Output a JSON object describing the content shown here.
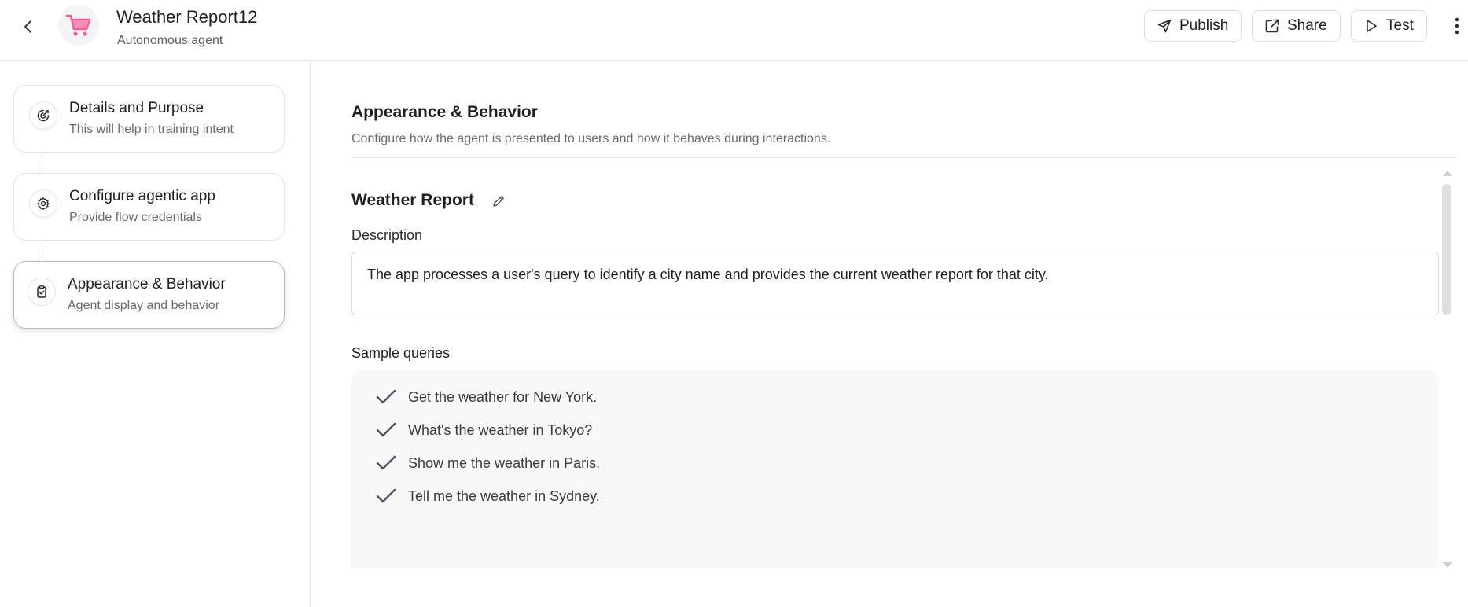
{
  "header": {
    "title": "Weather Report12",
    "subtitle": "Autonomous agent",
    "actions": {
      "publish": "Publish",
      "share": "Share",
      "test": "Test"
    },
    "icons": {
      "back": "chevron-left-icon",
      "logo": "shopping-cart-icon",
      "more": "more-vertical-icon"
    },
    "logo_color": "#f0609a"
  },
  "sidebar": {
    "steps": [
      {
        "title": "Details and Purpose",
        "subtitle": "This will help in training intent",
        "icon": "target-icon"
      },
      {
        "title": "Configure agentic app",
        "subtitle": "Provide flow credentials",
        "icon": "gear-icon"
      },
      {
        "title": "Appearance & Behavior",
        "subtitle": "Agent display and behavior",
        "icon": "clipboard-check-icon",
        "active": true
      }
    ]
  },
  "main": {
    "section_title": "Appearance & Behavior",
    "section_desc": "Configure how the agent is presented to users and how it behaves during interactions.",
    "agent_name": "Weather Report",
    "description_label": "Description",
    "description_value": "The app processes a user's query to identify a city name and provides the current weather report for that city.",
    "sample_queries_label": "Sample queries",
    "sample_queries": [
      "Get the weather for New York.",
      "What's the weather in Tokyo?",
      "Show me the weather in Paris.",
      "Tell me the weather in Sydney."
    ]
  }
}
